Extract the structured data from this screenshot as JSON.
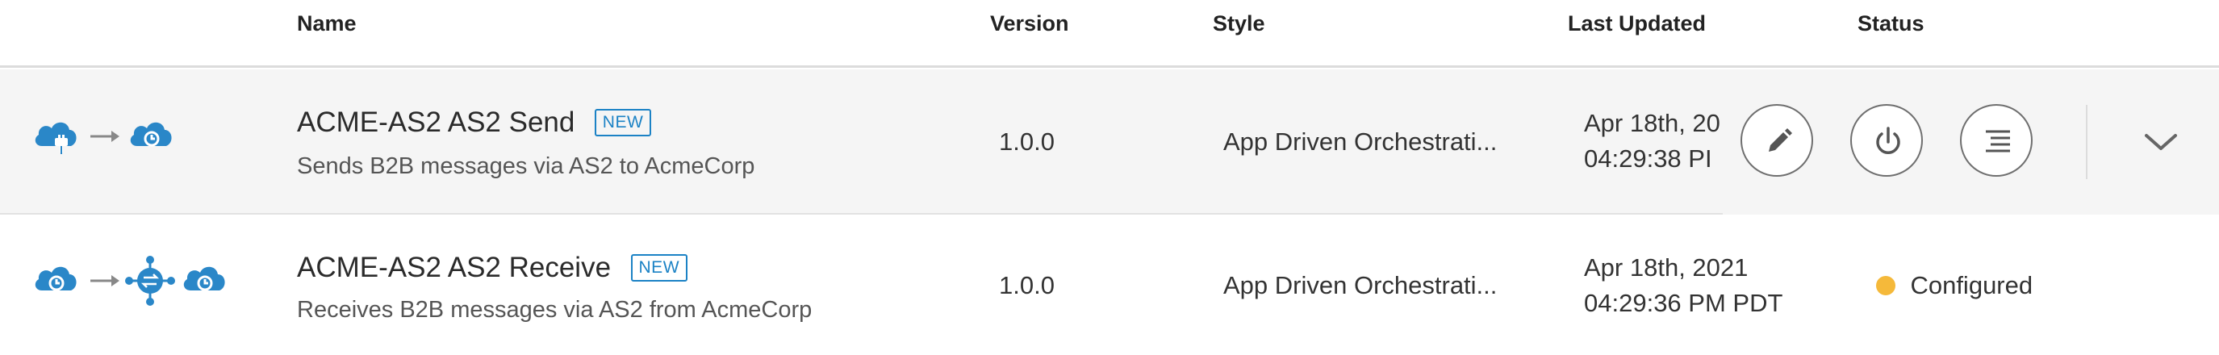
{
  "columns": {
    "name": "Name",
    "version": "Version",
    "style": "Style",
    "last_updated": "Last Updated",
    "status": "Status"
  },
  "colors": {
    "accent": "#1b82c5",
    "cloud": "#2a87c8",
    "status_configured": "#f5b93a",
    "row_hover": "#f5f5f5"
  },
  "rows": [
    {
      "name": "ACME-AS2 AS2 Send",
      "badge": "NEW",
      "description": "Sends B2B messages via AS2 to AcmeCorp",
      "version": "1.0.0",
      "style": "App Driven Orchestrati...",
      "updated_date": "Apr 18th, 20",
      "updated_time": "04:29:38 PI",
      "flow_icons": [
        "cloud-plug-icon",
        "arrow-right-icon",
        "cloud-integration-icon"
      ],
      "actions": [
        "pencil-icon",
        "power-icon",
        "menu-lines-icon",
        "chevron-down-icon"
      ]
    },
    {
      "name": "ACME-AS2 AS2 Receive",
      "badge": "NEW",
      "description": "Receives B2B messages via AS2 from AcmeCorp",
      "version": "1.0.0",
      "style": "App Driven Orchestrati...",
      "updated_date": "Apr 18th, 2021",
      "updated_time": "04:29:36 PM PDT",
      "status": "Configured",
      "flow_icons": [
        "cloud-integration-icon",
        "arrow-right-icon",
        "orchestration-hub-icon",
        "cloud-integration-icon"
      ]
    }
  ]
}
